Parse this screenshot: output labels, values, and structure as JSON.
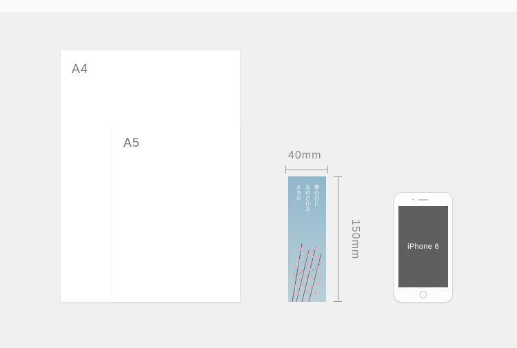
{
  "sheets": {
    "a4_label": "A4",
    "a5_label": "A5"
  },
  "bookmark": {
    "width_label": "40mm",
    "height_label": "150mm",
    "poem_line1": "久方の",
    "poem_line2": "光のどけき",
    "poem_line3": "春の日に"
  },
  "phone": {
    "model": "iPhone 6"
  }
}
